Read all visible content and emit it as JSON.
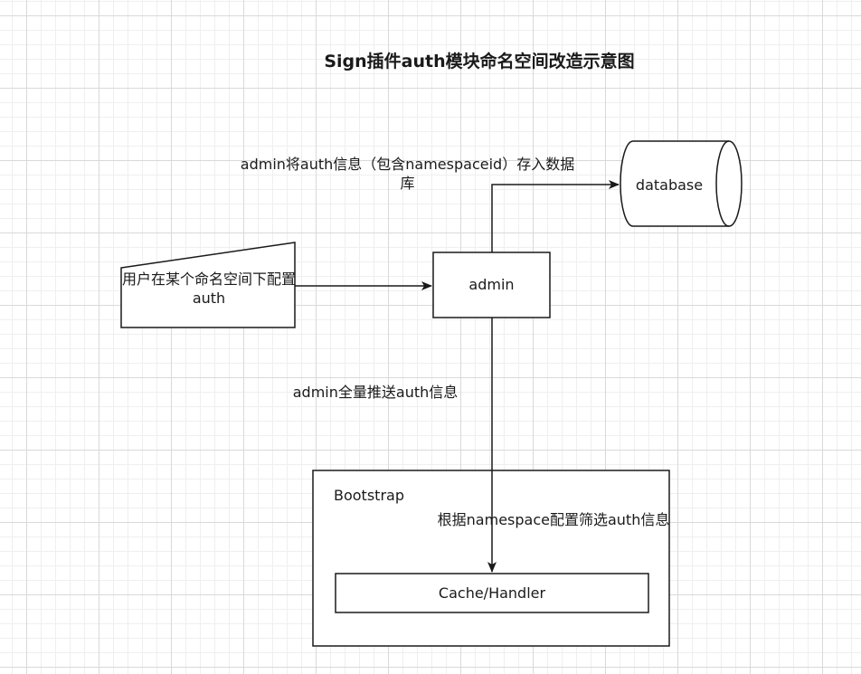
{
  "title": "Sign插件auth模块命名空间改造示意图",
  "nodes": {
    "user_input": "用户在某个命名空间下配置auth",
    "admin": "admin",
    "database": "database",
    "bootstrap": "Bootstrap",
    "cache_handler": "Cache/Handler"
  },
  "edges": {
    "admin_to_database": "admin将auth信息（包含namespaceid）存入数据库",
    "admin_to_cache": "admin全量推送auth信息",
    "bootstrap_filter": "根据namespace配置筛选auth信息"
  },
  "colors": {
    "stroke": "#1a1a1a",
    "fill": "#ffffff",
    "grid": "#d9d9d9"
  }
}
